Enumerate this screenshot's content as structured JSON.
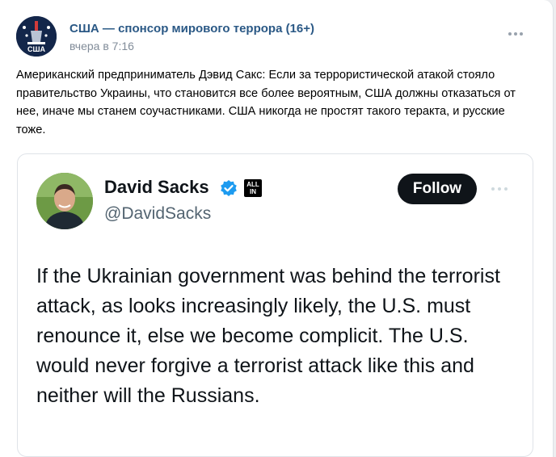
{
  "post": {
    "author": "США — спонсор мирового террора (16+)",
    "avatar_label": "США",
    "date": "вчера в 7:16",
    "text": "Американский предприниматель Дэвид Сакс: Если за террористической атакой стояло правительство Украины, что становится все более вероятным, США должны отказаться от нее, иначе мы станем соучастниками. США никогда не простят такого теракта, и русские тоже."
  },
  "tweet": {
    "name": "David Sacks",
    "handle": "@DavidSacks",
    "affiliate_badge": [
      "ALL",
      "IN"
    ],
    "follow_label": "Follow",
    "text": "If the Ukrainian government was behind the terrorist attack, as looks increasingly likely, the U.S. must renounce it, else we become complicit. The U.S. would never forgive a terrorist attack like this and neither will the Russians."
  },
  "icons": {
    "post_menu": "more-horizontal-icon",
    "tweet_menu": "more-horizontal-icon",
    "verified": "verified-check-icon"
  },
  "colors": {
    "author_link": "#2a5885",
    "muted": "#818c99",
    "verified_blue": "#1d9bf0",
    "follow_bg": "#0f1419"
  }
}
